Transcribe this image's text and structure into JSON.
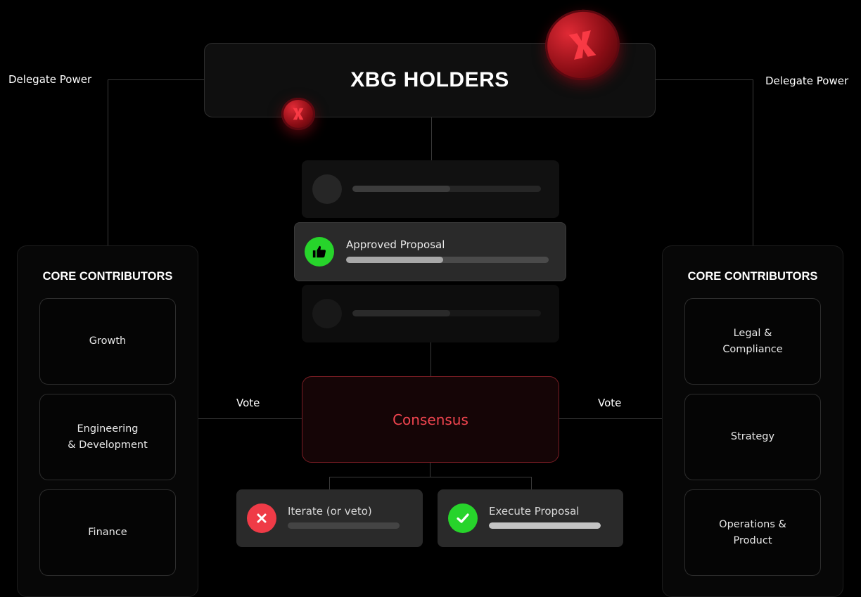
{
  "holders": {
    "title": "XBG HOLDERS"
  },
  "delegate": {
    "left": "Delegate Power",
    "right": "Delegate Power"
  },
  "vote": {
    "left": "Vote",
    "right": "Vote"
  },
  "left_panel": {
    "title": "CORE CONTRIBUTORS",
    "items": [
      "Growth",
      "Engineering\n& Development",
      "Finance"
    ]
  },
  "right_panel": {
    "title": "CORE CONTRIBUTORS",
    "items": [
      "Legal &\nCompliance",
      "Strategy",
      "Operations &\nProduct"
    ]
  },
  "proposal": {
    "label": "Approved Proposal",
    "progress": 0.48
  },
  "placeholder_progress": 0.52,
  "consensus": {
    "label": "Consensus"
  },
  "outcomes": {
    "iterate": {
      "label": "Iterate (or veto)",
      "progress": 0
    },
    "execute": {
      "label": "Execute Proposal",
      "progress": 1.0
    }
  },
  "colors": {
    "approve_green": "#27d42b",
    "reject_red": "#ef3b47",
    "consensus_red": "#f0454f",
    "brand_red": "#c8161f"
  },
  "icons": {
    "approve": "thumbs-up-icon",
    "reject": "x-icon",
    "execute": "check-icon",
    "coin": "xbg-coin-icon"
  }
}
